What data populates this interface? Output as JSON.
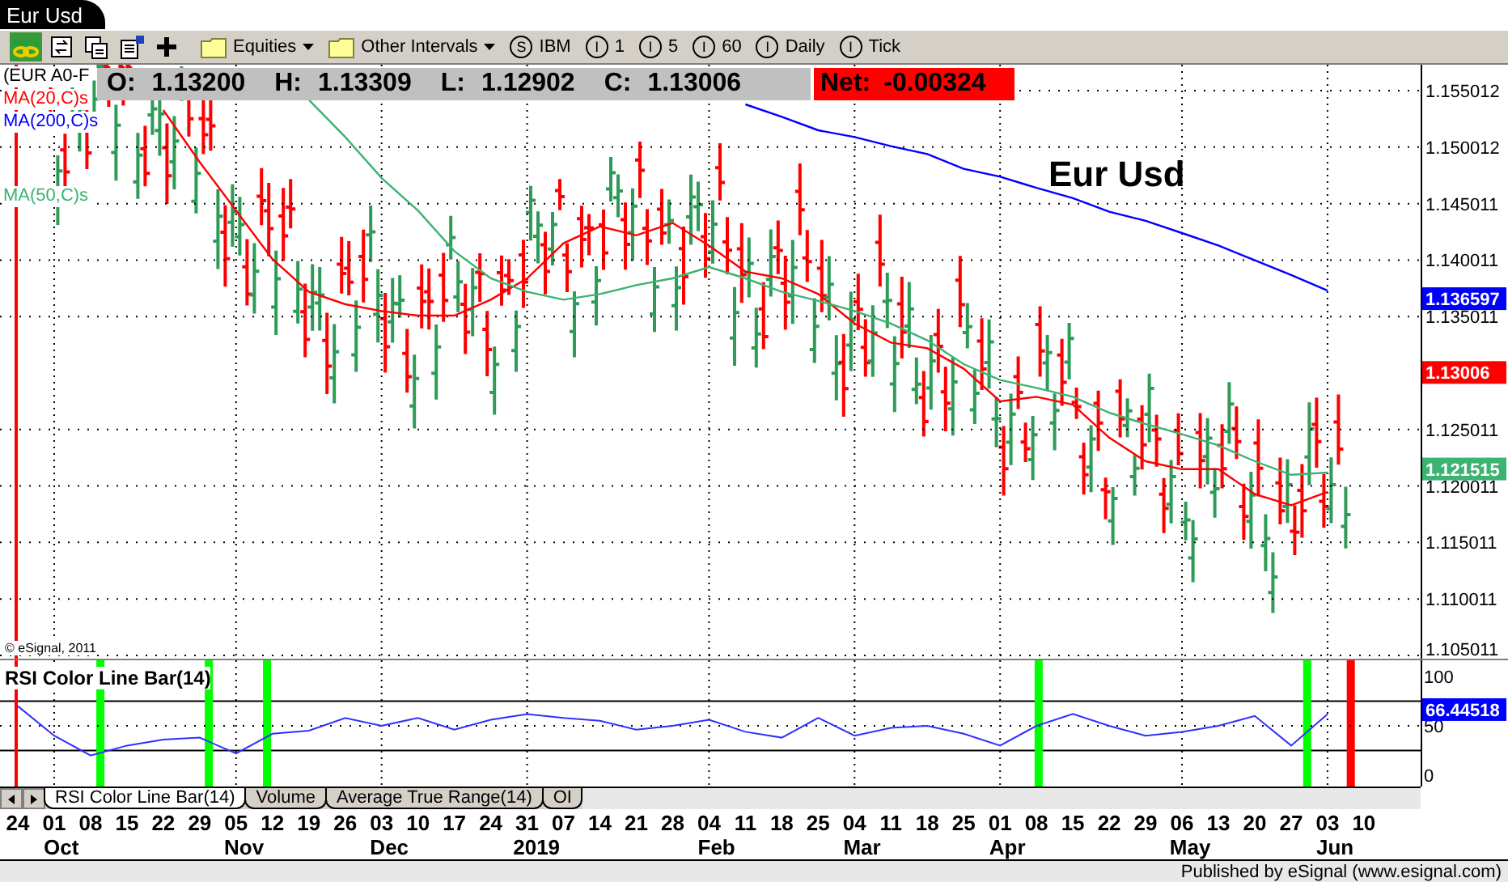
{
  "window": {
    "title": "Eur Usd"
  },
  "toolbar": {
    "folders": [
      {
        "label": "Equities"
      },
      {
        "label": "Other Intervals"
      }
    ],
    "symbols": [
      {
        "badge": "S",
        "label": "IBM"
      },
      {
        "badge": "I",
        "label": "1"
      },
      {
        "badge": "I",
        "label": "5"
      },
      {
        "badge": "I",
        "label": "60"
      },
      {
        "badge": "I",
        "label": "Daily"
      },
      {
        "badge": "I",
        "label": "Tick"
      }
    ]
  },
  "quote_bar": {
    "fields": [
      {
        "label": "O:",
        "value": "1.13200"
      },
      {
        "label": "H:",
        "value": "1.13309"
      },
      {
        "label": "L:",
        "value": "1.12902"
      },
      {
        "label": "C:",
        "value": "1.13006"
      }
    ],
    "net": {
      "label": "Net:",
      "value": "-0.00324"
    }
  },
  "price_pane": {
    "title": "Eur Usd",
    "copyright": "© eSignal, 2011",
    "symbol_label": "(EUR A0-F",
    "value_tags": [
      {
        "text": "1.136597",
        "color": "#0000ff"
      },
      {
        "text": "1.13006",
        "color": "#ff0000"
      },
      {
        "text": "1.121515",
        "color": "#3cb371"
      }
    ],
    "chart_data": {
      "type": "line",
      "categories": [
        null,
        null,
        null,
        null,
        null,
        null,
        null,
        null,
        null,
        null,
        null,
        null,
        null,
        null,
        null,
        null,
        null,
        null,
        null,
        null,
        null,
        null,
        null,
        null,
        null,
        null,
        null,
        null,
        null,
        null,
        null,
        null,
        null,
        null,
        null,
        null,
        null,
        null
      ],
      "ylim": [
        1.10472,
        1.15731
      ],
      "grid": true,
      "yticks": [
        {
          "value": 1.155012,
          "label": "1.155012"
        },
        {
          "value": 1.150012,
          "label": "1.150012"
        },
        {
          "value": 1.145011,
          "label": "1.145011"
        },
        {
          "value": 1.140011,
          "label": "1.140011"
        },
        {
          "value": 1.135011,
          "label": "1.135011"
        },
        {
          "value": 1.125011,
          "label": "1.125011"
        },
        {
          "value": 1.120011,
          "label": "1.120011"
        },
        {
          "value": 1.115011,
          "label": "1.115011"
        },
        {
          "value": 1.110011,
          "label": "1.110011"
        },
        {
          "value": 1.105011,
          "label": "1.105011"
        }
      ],
      "series": [
        {
          "name": "MA(20,C)s",
          "color": "#ff0000",
          "values": [
            null,
            null,
            null,
            null,
            1.1533,
            1.1487,
            1.1444,
            1.1401,
            1.1372,
            1.1361,
            1.1355,
            1.1351,
            1.1351,
            1.1365,
            1.1384,
            1.1415,
            1.143,
            1.1422,
            1.1433,
            1.1413,
            1.139,
            1.1384,
            1.137,
            1.1344,
            1.1327,
            1.1322,
            1.1304,
            1.1275,
            1.1279,
            1.1272,
            1.1243,
            1.1222,
            1.1215,
            1.1215,
            1.1193,
            1.1183,
            1.1195,
            null
          ]
        },
        {
          "name": "MA(200,C)s",
          "color": "#0000ff",
          "values": [
            null,
            null,
            null,
            null,
            null,
            null,
            null,
            null,
            null,
            null,
            null,
            null,
            null,
            null,
            null,
            null,
            null,
            null,
            null,
            null,
            1.1538,
            1.1527,
            1.1515,
            1.1509,
            1.1501,
            1.1494,
            1.1481,
            1.1474,
            1.1464,
            1.1455,
            1.1443,
            1.1435,
            1.1424,
            1.1413,
            1.14,
            1.1387,
            1.1373,
            null
          ]
        },
        {
          "name": "MA(50,C)s",
          "color": "#3cb371",
          "values": [
            null,
            null,
            null,
            null,
            null,
            null,
            null,
            null,
            1.1542,
            1.1509,
            1.1473,
            1.1444,
            1.1408,
            1.1384,
            1.1372,
            1.1365,
            1.137,
            1.1378,
            1.1384,
            1.1394,
            1.1384,
            1.1372,
            1.1364,
            1.1355,
            1.1344,
            1.1329,
            1.1308,
            1.1294,
            1.1287,
            1.1279,
            1.1265,
            1.1255,
            1.1246,
            1.1236,
            1.1222,
            1.121,
            1.1212,
            null
          ]
        }
      ]
    }
  },
  "rsi_pane": {
    "title": "RSI Color Line Bar(14)",
    "value_tags": [
      {
        "text": "66.44518",
        "color": "#0000ff"
      }
    ],
    "chart_data": {
      "type": "line",
      "categories": [
        "24",
        "01",
        "08",
        "15",
        "22",
        "29",
        "05",
        "12",
        "19",
        "26",
        "03",
        "10",
        "17",
        "24",
        "31",
        "07",
        "14",
        "21",
        "28",
        "04",
        "11",
        "18",
        "25",
        "04",
        "11",
        "18",
        "25",
        "01",
        "08",
        "15",
        "22",
        "29",
        "06",
        "13",
        "20",
        "27",
        "03",
        "10"
      ],
      "ylim": [
        -11.5,
        116.4
      ],
      "yticks": [
        100,
        50,
        0
      ],
      "grid": true,
      "series": [
        {
          "color": "#3030ff",
          "values": [
            70,
            40,
            20,
            30,
            36,
            38,
            22,
            42,
            45,
            58,
            50,
            58,
            46,
            56,
            62,
            58,
            55,
            46,
            50,
            56,
            44,
            38,
            58,
            40,
            48,
            50,
            42,
            30,
            50,
            62,
            50,
            40,
            44,
            50,
            60,
            30,
            62,
            null
          ]
        }
      ]
    }
  },
  "study_tabs": [
    {
      "label": "RSI Color Line Bar(14)",
      "selected": true
    },
    {
      "label": "Volume",
      "selected": false
    },
    {
      "label": "Average True Range(14)",
      "selected": false
    },
    {
      "label": "OI",
      "selected": false
    }
  ],
  "date_axis": {
    "months": [
      {
        "label": "Oct"
      },
      {
        "label": "Nov"
      },
      {
        "label": "Dec"
      },
      {
        "label": "2019"
      },
      {
        "label": "Feb"
      },
      {
        "label": "Mar"
      },
      {
        "label": "Apr"
      },
      {
        "label": "May"
      },
      {
        "label": "Jun"
      }
    ]
  },
  "status_bar": {
    "text": "Published by eSignal (www.esignal.com)"
  }
}
